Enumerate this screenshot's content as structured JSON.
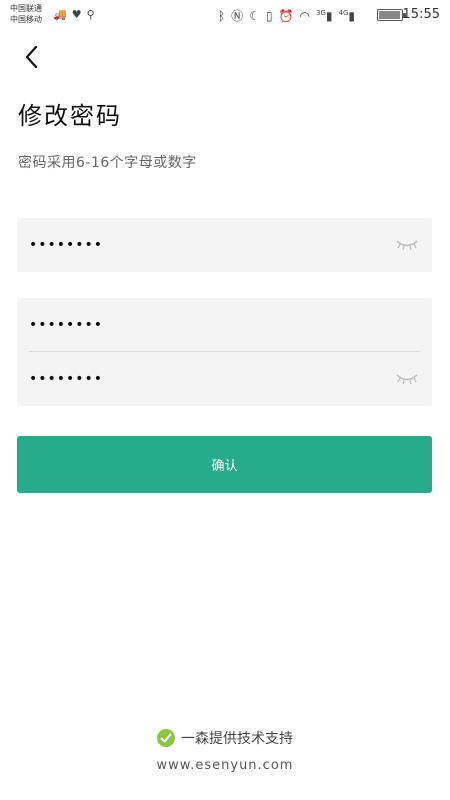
{
  "status_bar": {
    "carrier_1": "中国联通",
    "carrier_2": "中国移动",
    "net_3g": "3G",
    "net_4g": "4G",
    "battery_level": 0.95,
    "time": "15:55"
  },
  "header": {
    "title": "修改密码",
    "subtitle": "密码采用6-16个字母或数字"
  },
  "form": {
    "old_password_value": "••••••••",
    "new_password_value": "••••••••",
    "confirm_password_value": "••••••••",
    "submit_label": "确认"
  },
  "footer": {
    "support_text": "一森提供技术支持",
    "website": "www.esenyun.com"
  },
  "colors": {
    "accent": "#26ab8b",
    "field_bg": "#f4f4f4",
    "check": "#8cc63f"
  }
}
